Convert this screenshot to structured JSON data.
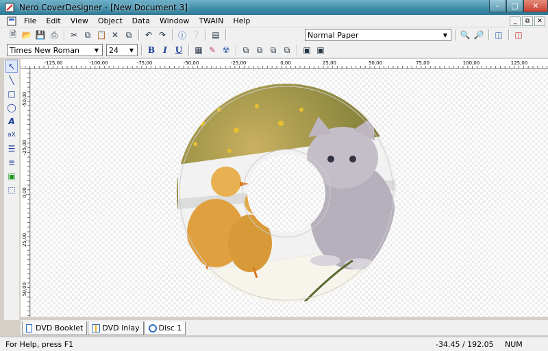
{
  "window": {
    "title": "Nero CoverDesigner - [New Document 3]",
    "minimize": "–",
    "maximize": "□",
    "close": "✕"
  },
  "menu": [
    "File",
    "Edit",
    "View",
    "Object",
    "Data",
    "Window",
    "TWAIN",
    "Help"
  ],
  "toolbar1": {
    "paper_select": "Normal Paper"
  },
  "toolbar2": {
    "font_family": "Times New Roman",
    "font_size": "24",
    "bold": "B",
    "italic": "I",
    "underline": "U"
  },
  "ruler": {
    "top_labels": [
      "-125,00",
      "-100,00",
      "-75,00",
      "-50,00",
      "-25,00",
      "0,00",
      "25,00",
      "50,00",
      "75,00",
      "100,00",
      "125,00"
    ],
    "left_labels": [
      "-50,00",
      "-25,00",
      "0,00",
      "25,00",
      "50,00"
    ]
  },
  "tabs": [
    {
      "label": "DVD Booklet",
      "icon": "booklet-icon"
    },
    {
      "label": "DVD Inlay",
      "icon": "inlay-icon"
    },
    {
      "label": "Disc 1",
      "icon": "disc-icon"
    }
  ],
  "status": {
    "help": "For Help, press F1",
    "coords": "-34.45 / 192.05",
    "num": "NUM"
  },
  "colors": {
    "title_gradient_top": "#6fb0c8",
    "close_button": "#c8402f",
    "chrome": "#f0f0f0"
  }
}
